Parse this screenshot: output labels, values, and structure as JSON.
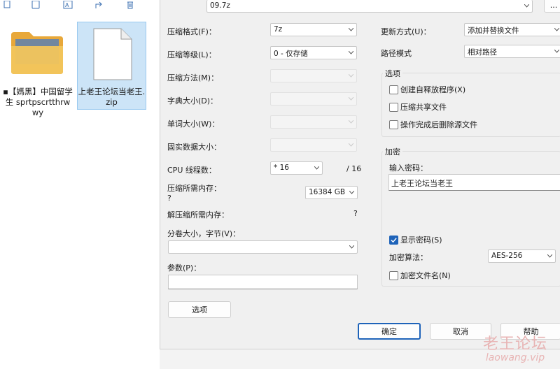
{
  "explorer": {
    "files": [
      {
        "name": "▪【媽黑】中国留学生 sprtpscrtthrwwy",
        "icon": "folder-icon"
      },
      {
        "name": "上老王论坛当老王.zip",
        "icon": "zip-file-icon"
      }
    ]
  },
  "dialog": {
    "archive_name": "09.7z",
    "browse_label": "...",
    "left": {
      "format_label": "压缩格式(F)：",
      "format_value": "7z",
      "level_label": "压缩等级(L)：",
      "level_value": "0 - 仅存储",
      "method_label": "压缩方法(M)：",
      "dict_label": "字典大小(D)：",
      "word_label": "单词大小(W)：",
      "solid_label": "固实数据大小：",
      "threads_label": "CPU 线程数：",
      "threads_value": "* 16",
      "threads_total": "/ 16",
      "mem_compress_label": "压缩所需内存：",
      "mem_compress_value": "?",
      "mem_limit_value": "16384 GB",
      "mem_decompress_label": "解压缩所需内存：",
      "mem_decompress_value": "?",
      "volume_label": "分卷大小，字节(V)：",
      "volume_value": "",
      "params_label": "参数(P)：",
      "params_value": "",
      "options_button": "选项"
    },
    "right": {
      "update_label": "更新方式(U)：",
      "update_value": "添加并替换文件",
      "path_label": "路径模式",
      "path_value": "相对路径",
      "options_group": "选项",
      "opt_sfx": "创建自释放程序(X)",
      "opt_shared": "压缩共享文件",
      "opt_delete": "操作完成后删除源文件",
      "encrypt_group": "加密",
      "password_label": "输入密码：",
      "password_value": "上老王论坛当老王",
      "show_password": "显示密码(S)",
      "enc_method_label": "加密算法：",
      "enc_method_value": "AES-256",
      "encrypt_names": "加密文件名(N)"
    },
    "buttons": {
      "ok": "确定",
      "cancel": "取消",
      "help": "帮助"
    }
  },
  "watermark": {
    "title": "老王论坛",
    "url": "laowang.vip"
  },
  "colors": {
    "accent": "#1e63b9",
    "selection": "#cce4f7",
    "folder": "#f2c55c"
  }
}
